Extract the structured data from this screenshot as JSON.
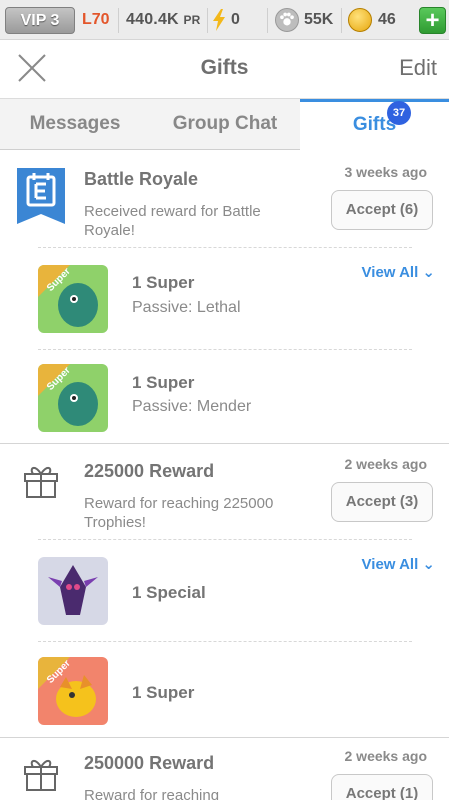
{
  "statusbar": {
    "vip": "VIP 3",
    "level": "L70",
    "power_value": "440.4K",
    "power_unit": "PR",
    "energy": "0",
    "food": "55K",
    "gold": "46",
    "plus": "+",
    "icons": [
      "bolt-icon",
      "paw-icon",
      "coin-icon",
      "plus-icon"
    ]
  },
  "header": {
    "title": "Gifts",
    "edit": "Edit"
  },
  "tabs": {
    "items": [
      {
        "label": "Messages"
      },
      {
        "label": "Group Chat"
      },
      {
        "label": "Gifts"
      }
    ],
    "badge": "37",
    "active": 2
  },
  "groups": [
    {
      "title": "Battle Royale",
      "desc": "Received reward for Battle Royale!",
      "time": "3 weeks ago",
      "accept": "Accept (6)",
      "icon": "calendar-icon",
      "view_all": "View All",
      "items": [
        {
          "title": "1 Super",
          "sub": "Passive: Lethal",
          "tag": "Super",
          "bg": "#8fd16a"
        },
        {
          "title": "1 Super",
          "sub": "Passive: Mender",
          "tag": "Super",
          "bg": "#8fd16a"
        }
      ]
    },
    {
      "title": "225000 Reward",
      "desc": "Reward for reaching 225000 Trophies!",
      "time": "2 weeks ago",
      "accept": "Accept (3)",
      "icon": "gift-icon",
      "view_all": "View All",
      "items": [
        {
          "title": "1 Special",
          "sub": "",
          "tag": "",
          "bg": "#d6d8e6"
        },
        {
          "title": "1 Super",
          "sub": "",
          "tag": "Super",
          "bg": "#f2846c"
        }
      ]
    },
    {
      "title": "250000 Reward",
      "desc": "Reward for reaching",
      "time": "2 weeks ago",
      "accept": "Accept (1)",
      "icon": "gift-icon"
    }
  ],
  "colors": {
    "accent": "#3a8ee0",
    "badge": "#2f62e0",
    "danger": "#e3562b",
    "success": "#2f9b32"
  }
}
